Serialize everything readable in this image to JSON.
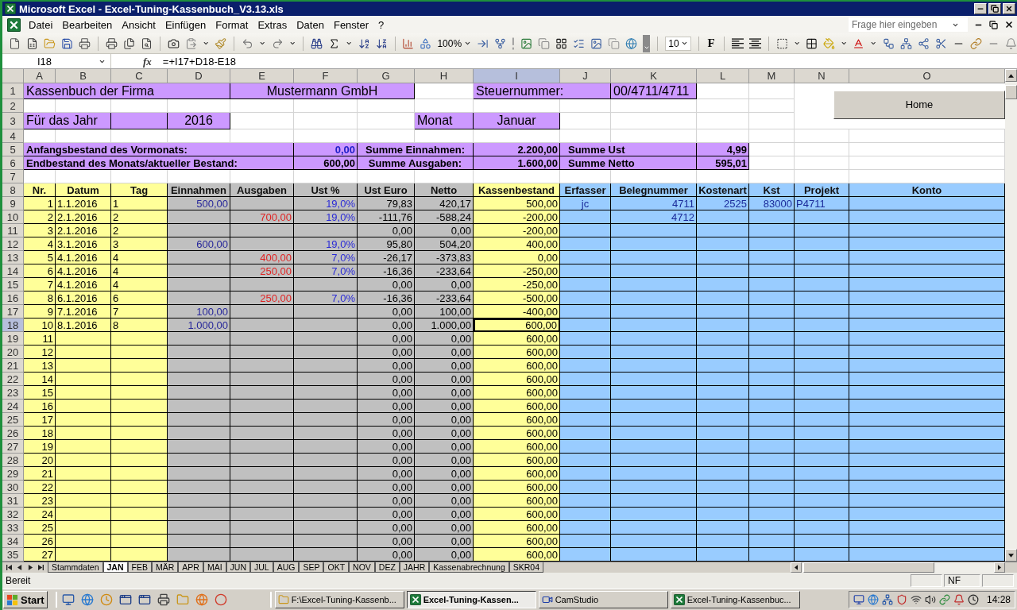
{
  "window": {
    "title": "Microsoft Excel - Excel-Tuning-Kassenbuch_V3.13.xls"
  },
  "menu": [
    "Datei",
    "Bearbeiten",
    "Ansicht",
    "Einfügen",
    "Format",
    "Extras",
    "Daten",
    "Fenster",
    "?"
  ],
  "help_search": {
    "placeholder": "Frage hier eingeben"
  },
  "toolbar": {
    "zoom": "100%",
    "font_size": "10",
    "bold": "F"
  },
  "formula_bar": {
    "name_box": "I18",
    "insert_function": "fx",
    "formula": "=+I17+D18-E18"
  },
  "sheet": {
    "home_button": "Home",
    "columns": [
      {
        "label": "A",
        "selected": false
      },
      {
        "label": "B",
        "selected": false
      },
      {
        "label": "C",
        "selected": false
      },
      {
        "label": "D",
        "selected": false
      },
      {
        "label": "E",
        "selected": false
      },
      {
        "label": "F",
        "selected": false
      },
      {
        "label": "G",
        "selected": false
      },
      {
        "label": "H",
        "selected": false
      },
      {
        "label": "I",
        "selected": true
      },
      {
        "label": "J",
        "selected": false
      },
      {
        "label": "K",
        "selected": false
      },
      {
        "label": "L",
        "selected": false
      },
      {
        "label": "M",
        "selected": false
      },
      {
        "label": "N",
        "selected": false
      },
      {
        "label": "O",
        "selected": false
      }
    ],
    "rows": [
      {
        "number": "1",
        "kind": "title",
        "selected": false,
        "company_label": "Kassenbuch der Firma",
        "company": "Mustermann GmbH",
        "tax_label": "Steuernummer:",
        "tax_number": "00/4711/4711"
      },
      {
        "number": "2",
        "kind": "blank",
        "selected": false
      },
      {
        "number": "3",
        "kind": "period",
        "selected": false,
        "year_label": "Für das Jahr",
        "year": "2016",
        "month_label": "Monat",
        "month": "Januar"
      },
      {
        "number": "4",
        "kind": "blank",
        "selected": false
      },
      {
        "number": "5",
        "kind": "summary",
        "selected": false,
        "items": [
          {
            "label": "Anfangsbestand des Vormonats:",
            "value": "0,00",
            "kind": "input"
          },
          {
            "label": "Summe Einnahmen:",
            "value": "2.200,00",
            "kind": "computed"
          },
          {
            "label": "Summe Ust",
            "value": "4,99",
            "kind": "computed"
          }
        ]
      },
      {
        "number": "6",
        "kind": "summary",
        "selected": false,
        "items": [
          {
            "label": "Endbestand des Monats/aktueller Bestand:",
            "value": "600,00",
            "kind": "computed"
          },
          {
            "label": "Summe Ausgaben:",
            "value": "1.600,00",
            "kind": "computed"
          },
          {
            "label": "Summe Netto",
            "value": "595,01",
            "kind": "computed"
          }
        ]
      },
      {
        "number": "7",
        "kind": "blank",
        "selected": false
      },
      {
        "number": "8",
        "kind": "header",
        "selected": false,
        "cells": [
          "Nr.",
          "Datum",
          "Tag",
          "Einnahmen",
          "Ausgaben",
          "Ust %",
          "Ust Euro",
          "Netto",
          "Kassenbestand",
          "Erfasser",
          "Belegnummer",
          "Kostenart",
          "Kst",
          "Projekt",
          "Konto"
        ]
      },
      {
        "number": "9",
        "kind": "entry",
        "selected": false,
        "nr": "1",
        "datum": "1.1.2016",
        "tag": "1",
        "einnahmen": "500,00",
        "ust_pct": "19,0%",
        "ust_euro": "79,83",
        "netto": "420,17",
        "kassenbestand": "500,00",
        "erfasser": "jc",
        "belegnummer": "4711",
        "kostenart": "2525",
        "kst": "83000",
        "projekt": "P4711"
      },
      {
        "number": "10",
        "kind": "entry",
        "selected": false,
        "nr": "2",
        "datum": "2.1.2016",
        "tag": "2",
        "ausgaben": "700,00",
        "ust_pct": "19,0%",
        "ust_euro": "-111,76",
        "netto": "-588,24",
        "kassenbestand": "-200,00",
        "belegnummer": "4712"
      },
      {
        "number": "11",
        "kind": "entry",
        "selected": false,
        "nr": "3",
        "datum": "2.1.2016",
        "tag": "2",
        "ust_euro": "0,00",
        "netto": "0,00",
        "kassenbestand": "-200,00"
      },
      {
        "number": "12",
        "kind": "entry",
        "selected": false,
        "nr": "4",
        "datum": "3.1.2016",
        "tag": "3",
        "einnahmen": "600,00",
        "ust_pct": "19,0%",
        "ust_euro": "95,80",
        "netto": "504,20",
        "kassenbestand": "400,00"
      },
      {
        "number": "13",
        "kind": "entry",
        "selected": false,
        "nr": "5",
        "datum": "4.1.2016",
        "tag": "4",
        "ausgaben": "400,00",
        "ust_pct": "7,0%",
        "ust_euro": "-26,17",
        "netto": "-373,83",
        "kassenbestand": "0,00"
      },
      {
        "number": "14",
        "kind": "entry",
        "selected": false,
        "nr": "6",
        "datum": "4.1.2016",
        "tag": "4",
        "ausgaben": "250,00",
        "ust_pct": "7,0%",
        "ust_euro": "-16,36",
        "netto": "-233,64",
        "kassenbestand": "-250,00"
      },
      {
        "number": "15",
        "kind": "entry",
        "selected": false,
        "nr": "7",
        "datum": "4.1.2016",
        "tag": "4",
        "ust_euro": "0,00",
        "netto": "0,00",
        "kassenbestand": "-250,00"
      },
      {
        "number": "16",
        "kind": "entry",
        "selected": false,
        "nr": "8",
        "datum": "6.1.2016",
        "tag": "6",
        "ausgaben": "250,00",
        "ust_pct": "7,0%",
        "ust_euro": "-16,36",
        "netto": "-233,64",
        "kassenbestand": "-500,00"
      },
      {
        "number": "17",
        "kind": "entry",
        "selected": false,
        "nr": "9",
        "datum": "7.1.2016",
        "tag": "7",
        "einnahmen": "100,00",
        "ust_euro": "0,00",
        "netto": "100,00",
        "kassenbestand": "-400,00"
      },
      {
        "number": "18",
        "kind": "entry",
        "selected": true,
        "nr": "10",
        "datum": "8.1.2016",
        "tag": "8",
        "einnahmen": "1.000,00",
        "ust_euro": "0,00",
        "netto": "1.000,00",
        "kassenbestand": "600,00"
      },
      {
        "number": "19",
        "kind": "entry",
        "selected": false,
        "nr": "11",
        "ust_euro": "0,00",
        "netto": "0,00",
        "kassenbestand": "600,00"
      },
      {
        "number": "20",
        "kind": "entry",
        "selected": false,
        "nr": "12",
        "ust_euro": "0,00",
        "netto": "0,00",
        "kassenbestand": "600,00"
      },
      {
        "number": "21",
        "kind": "entry",
        "selected": false,
        "nr": "13",
        "ust_euro": "0,00",
        "netto": "0,00",
        "kassenbestand": "600,00"
      },
      {
        "number": "22",
        "kind": "entry",
        "selected": false,
        "nr": "14",
        "ust_euro": "0,00",
        "netto": "0,00",
        "kassenbestand": "600,00"
      },
      {
        "number": "23",
        "kind": "entry",
        "selected": false,
        "nr": "15",
        "ust_euro": "0,00",
        "netto": "0,00",
        "kassenbestand": "600,00"
      },
      {
        "number": "24",
        "kind": "entry",
        "selected": false,
        "nr": "16",
        "ust_euro": "0,00",
        "netto": "0,00",
        "kassenbestand": "600,00"
      },
      {
        "number": "25",
        "kind": "entry",
        "selected": false,
        "nr": "17",
        "ust_euro": "0,00",
        "netto": "0,00",
        "kassenbestand": "600,00"
      },
      {
        "number": "26",
        "kind": "entry",
        "selected": false,
        "nr": "18",
        "ust_euro": "0,00",
        "netto": "0,00",
        "kassenbestand": "600,00"
      },
      {
        "number": "27",
        "kind": "entry",
        "selected": false,
        "nr": "19",
        "ust_euro": "0,00",
        "netto": "0,00",
        "kassenbestand": "600,00"
      },
      {
        "number": "28",
        "kind": "entry",
        "selected": false,
        "nr": "20",
        "ust_euro": "0,00",
        "netto": "0,00",
        "kassenbestand": "600,00"
      },
      {
        "number": "29",
        "kind": "entry",
        "selected": false,
        "nr": "21",
        "ust_euro": "0,00",
        "netto": "0,00",
        "kassenbestand": "600,00"
      },
      {
        "number": "30",
        "kind": "entry",
        "selected": false,
        "nr": "22",
        "ust_euro": "0,00",
        "netto": "0,00",
        "kassenbestand": "600,00"
      },
      {
        "number": "31",
        "kind": "entry",
        "selected": false,
        "nr": "23",
        "ust_euro": "0,00",
        "netto": "0,00",
        "kassenbestand": "600,00"
      },
      {
        "number": "32",
        "kind": "entry",
        "selected": false,
        "nr": "24",
        "ust_euro": "0,00",
        "netto": "0,00",
        "kassenbestand": "600,00"
      },
      {
        "number": "33",
        "kind": "entry",
        "selected": false,
        "nr": "25",
        "ust_euro": "0,00",
        "netto": "0,00",
        "kassenbestand": "600,00"
      },
      {
        "number": "34",
        "kind": "entry",
        "selected": false,
        "nr": "26",
        "ust_euro": "0,00",
        "netto": "0,00",
        "kassenbestand": "600,00"
      },
      {
        "number": "35",
        "kind": "entry",
        "selected": false,
        "nr": "27",
        "ust_euro": "0,00",
        "netto": "0,00",
        "kassenbestand": "600,00"
      }
    ]
  },
  "sheet_tabs": [
    {
      "label": "Stammdaten",
      "selected": false
    },
    {
      "label": "JAN",
      "selected": true
    },
    {
      "label": "FEB",
      "selected": false
    },
    {
      "label": "MÄR",
      "selected": false
    },
    {
      "label": "APR",
      "selected": false
    },
    {
      "label": "MAI",
      "selected": false
    },
    {
      "label": "JUN",
      "selected": false
    },
    {
      "label": "JUL",
      "selected": false
    },
    {
      "label": "AUG",
      "selected": false
    },
    {
      "label": "SEP",
      "selected": false
    },
    {
      "label": "OKT",
      "selected": false
    },
    {
      "label": "NOV",
      "selected": false
    },
    {
      "label": "DEZ",
      "selected": false
    },
    {
      "label": "JAHR",
      "selected": false
    },
    {
      "label": "Kassenabrechnung",
      "selected": false
    },
    {
      "label": "SKR04",
      "selected": false
    }
  ],
  "status_bar": {
    "status": "Bereit",
    "indicator": "NF"
  },
  "taskbar": {
    "start": "Start",
    "tasks": [
      {
        "label": "F:\\Excel-Tuning-Kassenb...",
        "kind": "folder",
        "selected": false
      },
      {
        "label": "Excel-Tuning-Kassen...",
        "kind": "spreadsheet",
        "selected": true
      },
      {
        "label": "CamStudio",
        "kind": "recorder",
        "selected": false
      },
      {
        "label": "Excel-Tuning-Kassenbuc...",
        "kind": "spreadsheet",
        "selected": false
      }
    ],
    "clock": "14:28"
  }
}
